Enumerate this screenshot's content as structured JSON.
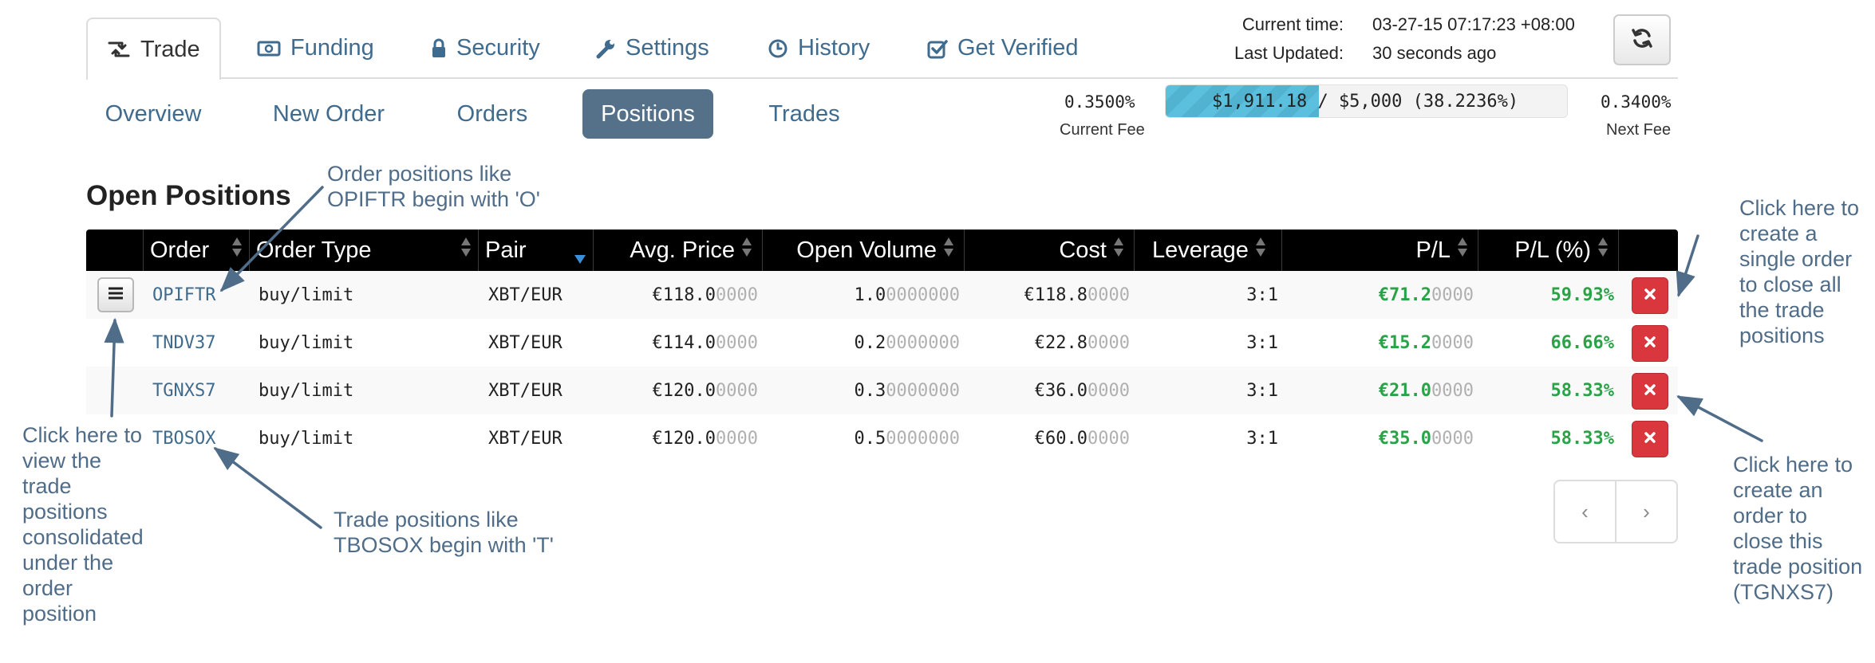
{
  "tabs": [
    {
      "label": "Trade",
      "icon": "retweet-icon",
      "active": true
    },
    {
      "label": "Funding",
      "icon": "money-icon",
      "active": false
    },
    {
      "label": "Security",
      "icon": "lock-icon",
      "active": false
    },
    {
      "label": "Settings",
      "icon": "wrench-icon",
      "active": false
    },
    {
      "label": "History",
      "icon": "clock-icon",
      "active": false
    },
    {
      "label": "Get Verified",
      "icon": "check-square-icon",
      "active": false
    }
  ],
  "status": {
    "current_time_label": "Current time:",
    "current_time_value": "03-27-15 07:17:23 +08:00",
    "last_updated_label": "Last Updated:",
    "last_updated_value": "30 seconds ago"
  },
  "subnav": [
    {
      "label": "Overview",
      "active": false
    },
    {
      "label": "New Order",
      "active": false
    },
    {
      "label": "Orders",
      "active": false
    },
    {
      "label": "Positions",
      "active": true
    },
    {
      "label": "Trades",
      "active": false
    }
  ],
  "fee": {
    "current_value": "0.3500%",
    "current_label": "Current Fee",
    "next_value": "0.3400%",
    "next_label": "Next Fee",
    "progress_text": "$1,911.18 / $5,000 (38.2236%)",
    "progress_fraction": 0.382236,
    "bar_color": "#5bc0de"
  },
  "section_title": "Open Positions",
  "table": {
    "headers": [
      "Order",
      "Order Type",
      "Pair",
      "Avg. Price",
      "Open Volume",
      "Cost",
      "Leverage",
      "P/L",
      "P/L (%)"
    ],
    "rows": [
      {
        "order": "OPIFTR",
        "type": "buy/limit",
        "pair": "XBT/EUR",
        "price_main": "€118.0",
        "price_pad": "0000",
        "vol_main": "1.0",
        "vol_pad": "0000000",
        "cost_main": "€118.8",
        "cost_pad": "0000",
        "leverage": "3:1",
        "pl_main": "€71.2",
        "pl_pad": "0000",
        "pl_pct": "59.93%"
      },
      {
        "order": "TNDV37",
        "type": "buy/limit",
        "pair": "XBT/EUR",
        "price_main": "€114.0",
        "price_pad": "0000",
        "vol_main": "0.2",
        "vol_pad": "0000000",
        "cost_main": "€22.8",
        "cost_pad": "0000",
        "leverage": "3:1",
        "pl_main": "€15.2",
        "pl_pad": "0000",
        "pl_pct": "66.66%"
      },
      {
        "order": "TGNXS7",
        "type": "buy/limit",
        "pair": "XBT/EUR",
        "price_main": "€120.0",
        "price_pad": "0000",
        "vol_main": "0.3",
        "vol_pad": "0000000",
        "cost_main": "€36.0",
        "cost_pad": "0000",
        "leverage": "3:1",
        "pl_main": "€21.0",
        "pl_pad": "0000",
        "pl_pct": "58.33%"
      },
      {
        "order": "TBOSOX",
        "type": "buy/limit",
        "pair": "XBT/EUR",
        "price_main": "€120.0",
        "price_pad": "0000",
        "vol_main": "0.5",
        "vol_pad": "0000000",
        "cost_main": "€60.0",
        "cost_pad": "0000",
        "leverage": "3:1",
        "pl_main": "€35.0",
        "pl_pad": "0000",
        "pl_pct": "58.33%"
      }
    ]
  },
  "pager": {
    "prev": "‹",
    "next": "›"
  },
  "annotations": {
    "order_positions": [
      "Order positions like",
      "OPIFTR begin with 'O'"
    ],
    "trade_positions": [
      "Trade positions like",
      "TBOSOX begin with 'T'"
    ],
    "view_consolidated": [
      "Click here to",
      "view the",
      "trade",
      "positions",
      "consolidated",
      "under the",
      "order",
      "position"
    ],
    "close_all": [
      "Click here to",
      "create a",
      "single order",
      "to close all",
      "the trade",
      "positions"
    ],
    "close_one": [
      "Click here to",
      "create an",
      "order to",
      "close this",
      "trade position",
      "(TGNXS7)"
    ]
  },
  "colors": {
    "link": "#3f6b8e",
    "active_pill": "#557189",
    "header_bg": "#000000",
    "profit": "#2aa347",
    "danger": "#d9363e",
    "annotation": "#4f6c88"
  }
}
